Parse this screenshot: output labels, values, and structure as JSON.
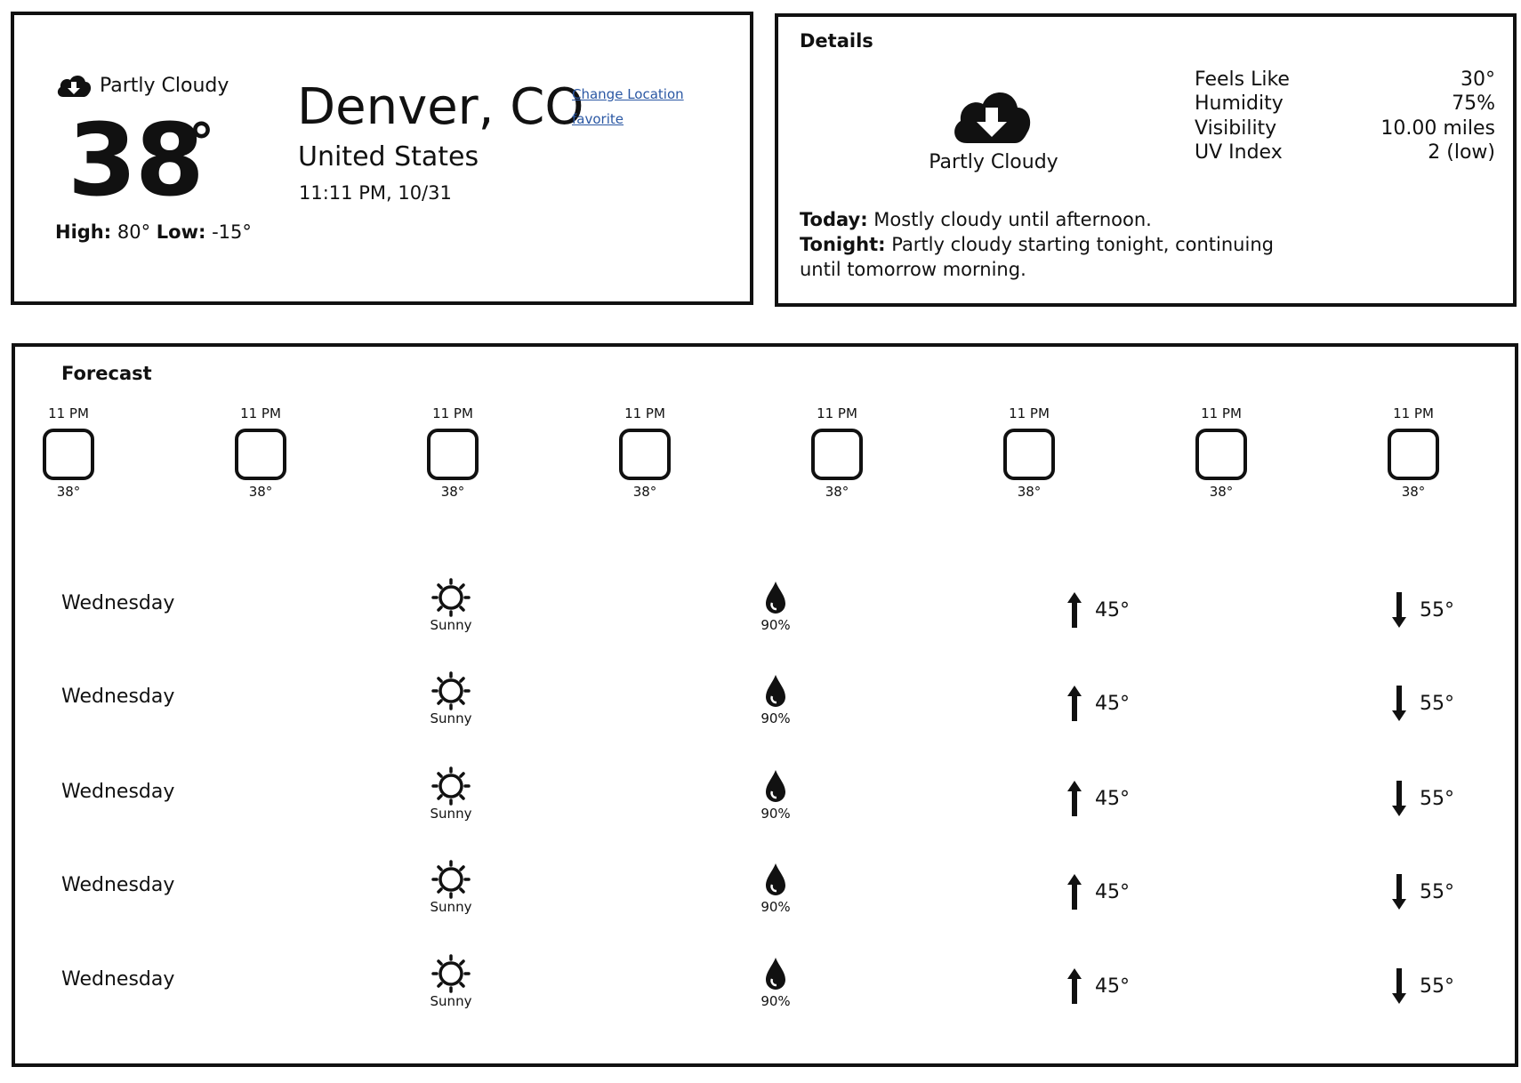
{
  "current": {
    "condition": "Partly Cloudy",
    "condition_icon": "cloud-download-icon",
    "temperature": "38",
    "degree_symbol": "°",
    "high_label": "High:",
    "high_value": "80°",
    "low_label": "Low:",
    "low_value": "-15°",
    "city": "Denver, CO",
    "country": "United States",
    "datetime": "11:11 PM, 10/31",
    "change_location_link": "Change Location",
    "favorite_link": "favorite"
  },
  "details": {
    "title": "Details",
    "icon": "cloud-download-icon",
    "condition": "Partly Cloudy",
    "stats": [
      {
        "label": "Feels Like",
        "value": "30°"
      },
      {
        "label": "Humidity",
        "value": "75%"
      },
      {
        "label": "Visibility",
        "value": "10.00 miles"
      },
      {
        "label": "UV Index",
        "value": "2 (low)"
      }
    ],
    "today_label": "Today:",
    "today_text": "Mostly cloudy until afternoon.",
    "tonight_label": "Tonight:",
    "tonight_text": "Partly cloudy starting tonight, continuing until tomorrow morning."
  },
  "forecast": {
    "title": "Forecast",
    "hourly": [
      {
        "time": "11 PM",
        "temp": "38°"
      },
      {
        "time": "11 PM",
        "temp": "38°"
      },
      {
        "time": "11 PM",
        "temp": "38°"
      },
      {
        "time": "11 PM",
        "temp": "38°"
      },
      {
        "time": "11 PM",
        "temp": "38°"
      },
      {
        "time": "11 PM",
        "temp": "38°"
      },
      {
        "time": "11 PM",
        "temp": "38°"
      },
      {
        "time": "11 PM",
        "temp": "38°"
      }
    ],
    "daily": [
      {
        "day": "Wednesday",
        "condition": "Sunny",
        "condition_icon": "sun-icon",
        "precip": "90%",
        "precip_icon": "droplet-icon",
        "high": "45°",
        "low": "55°"
      },
      {
        "day": "Wednesday",
        "condition": "Sunny",
        "condition_icon": "sun-icon",
        "precip": "90%",
        "precip_icon": "droplet-icon",
        "high": "45°",
        "low": "55°"
      },
      {
        "day": "Wednesday",
        "condition": "Sunny",
        "condition_icon": "sun-icon",
        "precip": "90%",
        "precip_icon": "droplet-icon",
        "high": "45°",
        "low": "55°"
      },
      {
        "day": "Wednesday",
        "condition": "Sunny",
        "condition_icon": "sun-icon",
        "precip": "90%",
        "precip_icon": "droplet-icon",
        "high": "45°",
        "low": "55°"
      },
      {
        "day": "Wednesday",
        "condition": "Sunny",
        "condition_icon": "sun-icon",
        "precip": "90%",
        "precip_icon": "droplet-icon",
        "high": "45°",
        "low": "55°"
      }
    ]
  },
  "colors": {
    "border": "#111111",
    "link": "#2a57a3",
    "background": "#ffffff"
  }
}
